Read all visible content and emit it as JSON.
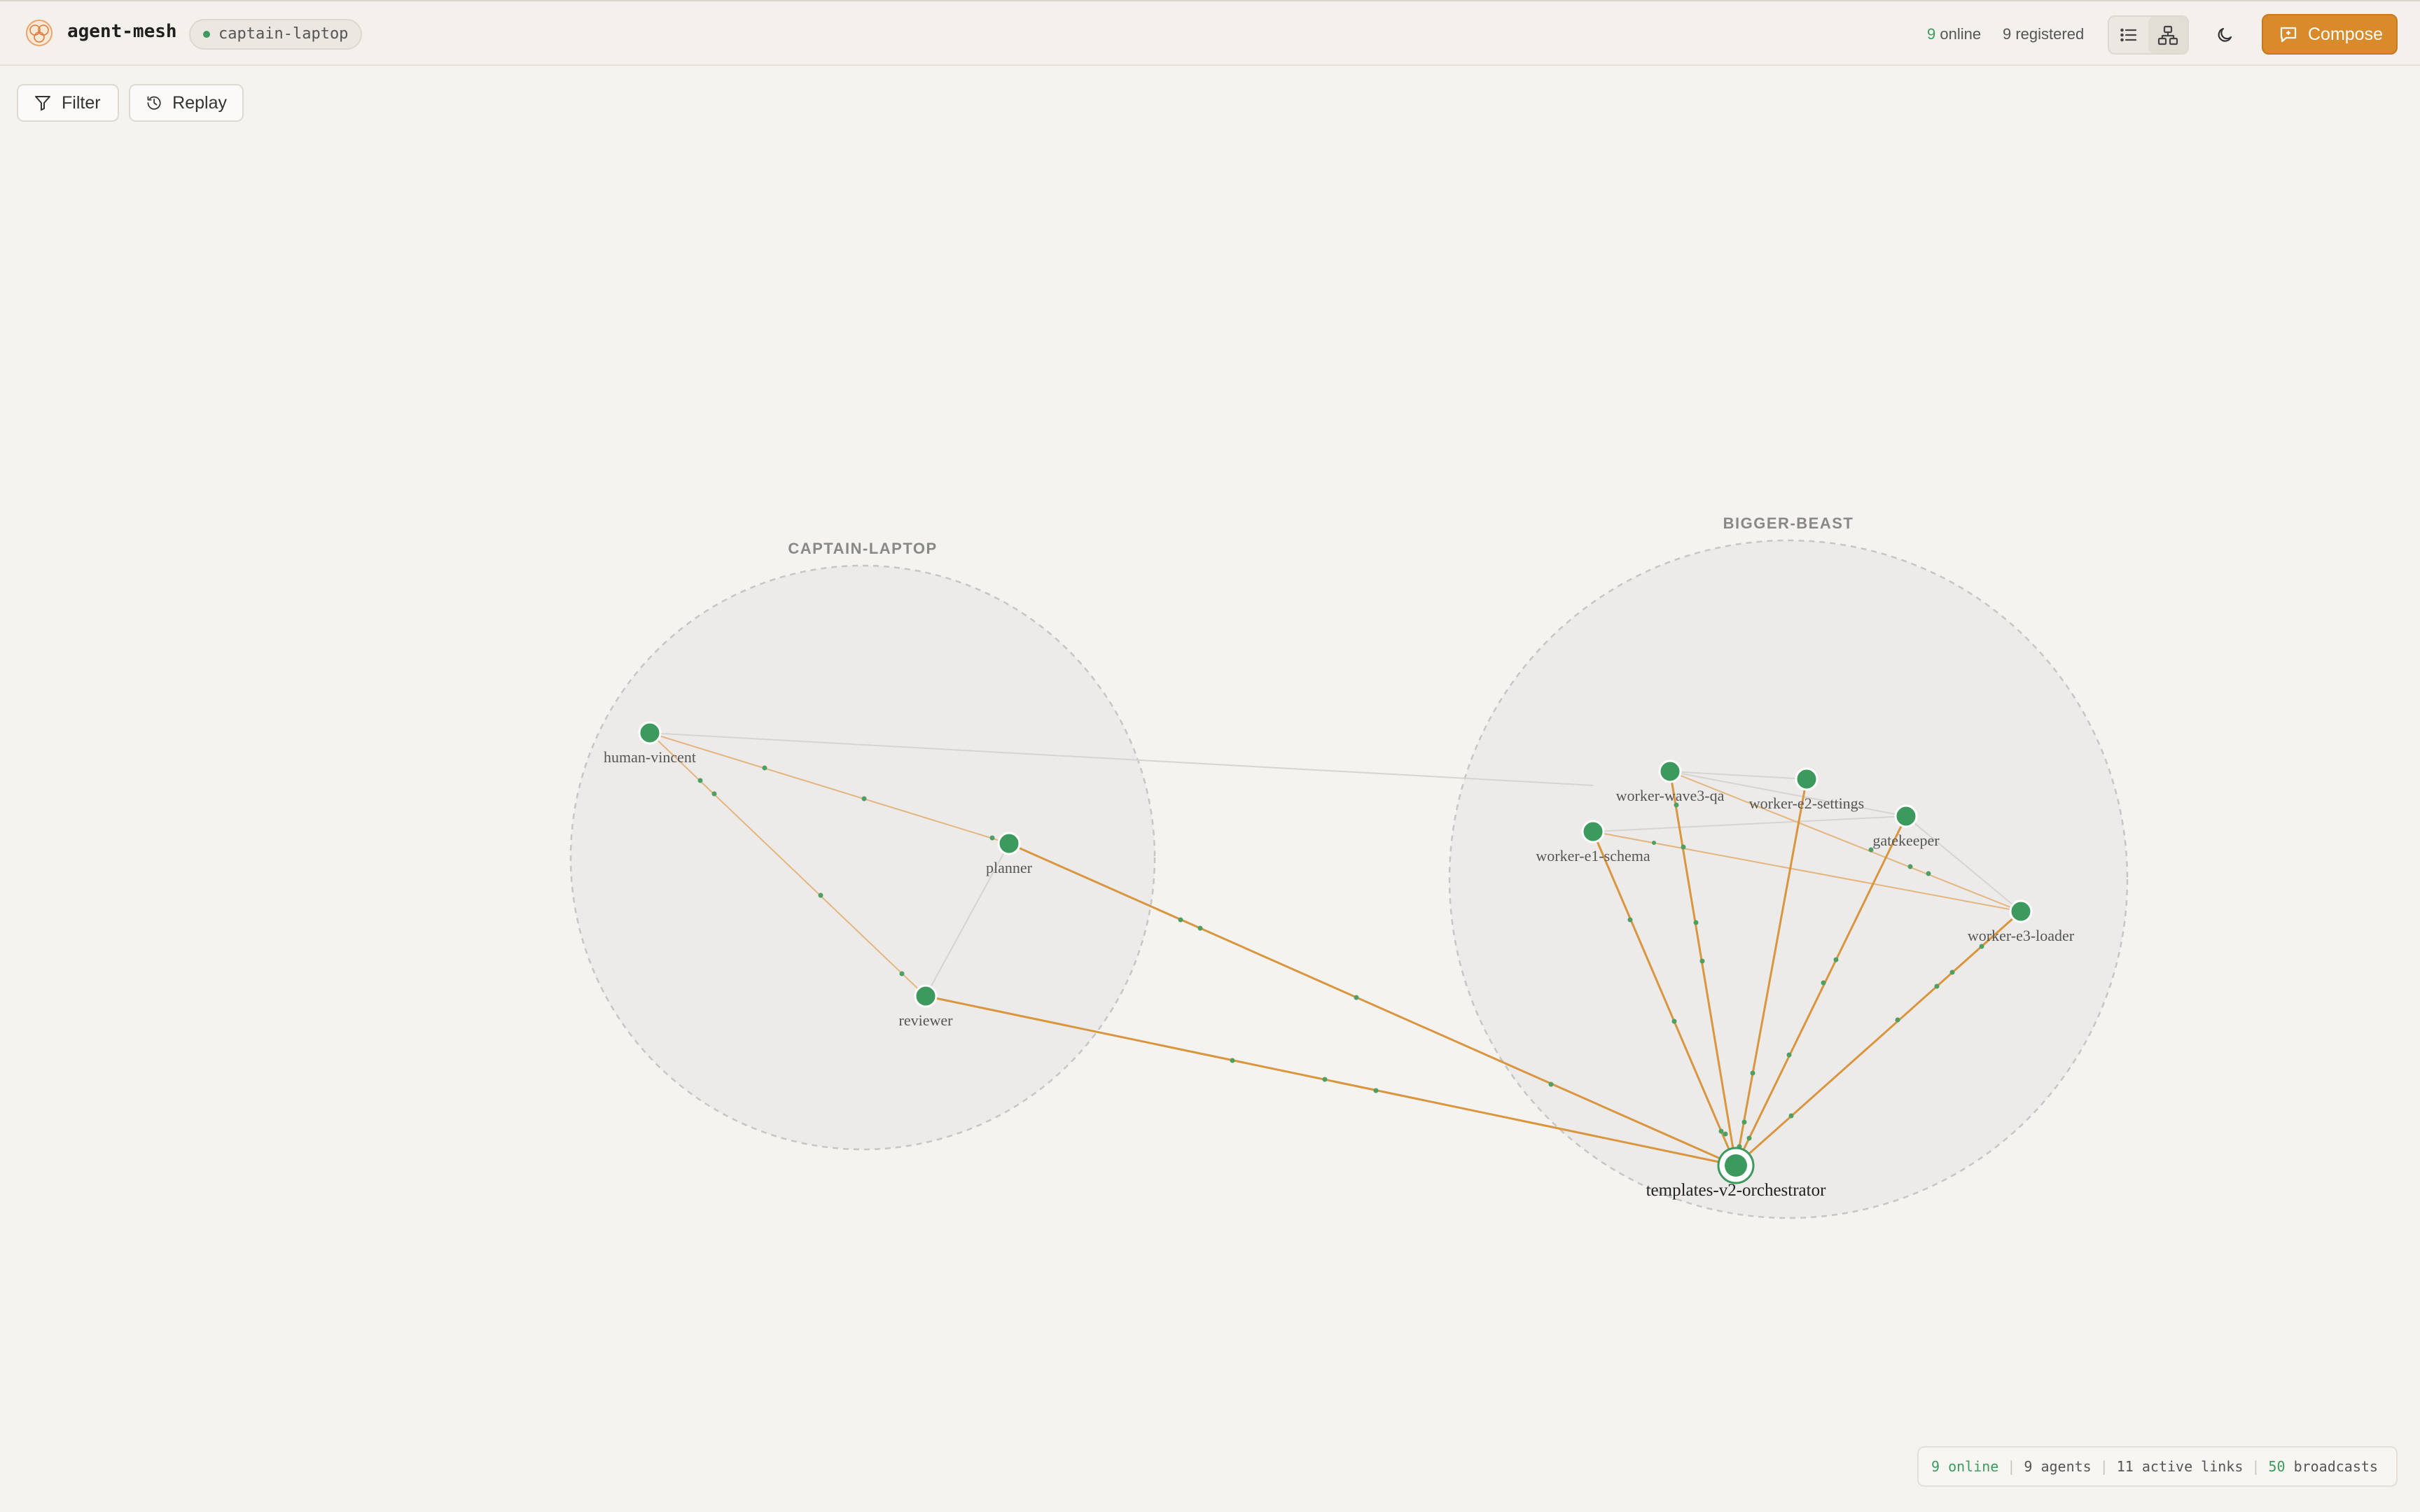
{
  "app": {
    "name": "agent-mesh",
    "host": "captain-laptop"
  },
  "header": {
    "online_count": "9",
    "online_label": "online",
    "registered_text": "9 registered",
    "compose_label": "Compose",
    "icons": [
      "list-view-icon",
      "graph-view-icon",
      "moon-icon",
      "compose-icon"
    ]
  },
  "toolbar": {
    "filter_label": "Filter",
    "replay_label": "Replay"
  },
  "graph": {
    "groups": [
      {
        "name": "CAPTAIN-LAPTOP"
      },
      {
        "name": "BIGGER-BEAST"
      }
    ],
    "nodes": [
      {
        "id": "human-vincent",
        "label": "human-vincent",
        "group": "CAPTAIN-LAPTOP"
      },
      {
        "id": "planner",
        "label": "planner",
        "group": "CAPTAIN-LAPTOP"
      },
      {
        "id": "reviewer",
        "label": "reviewer",
        "group": "CAPTAIN-LAPTOP"
      },
      {
        "id": "worker-wave3-qa",
        "label": "worker-wave3-qa",
        "group": "BIGGER-BEAST"
      },
      {
        "id": "worker-e2-settings",
        "label": "worker-e2-settings",
        "group": "BIGGER-BEAST"
      },
      {
        "id": "gatekeeper",
        "label": "gatekeeper",
        "group": "BIGGER-BEAST"
      },
      {
        "id": "worker-e1-schema",
        "label": "worker-e1-schema",
        "group": "BIGGER-BEAST"
      },
      {
        "id": "worker-e3-loader",
        "label": "worker-e3-loader",
        "group": "BIGGER-BEAST"
      },
      {
        "id": "templates-v2-orchestrator",
        "label": "templates-v2-orchestrator",
        "group": "BIGGER-BEAST"
      }
    ]
  },
  "status": {
    "online": "9 online",
    "agents": "9 agents",
    "links": "11 active links",
    "broadcasts_count": "50",
    "broadcasts_label": "broadcasts"
  },
  "colors": {
    "accent": "#d98a2b",
    "node": "#3c9a5f",
    "edge": "#d9963f"
  }
}
